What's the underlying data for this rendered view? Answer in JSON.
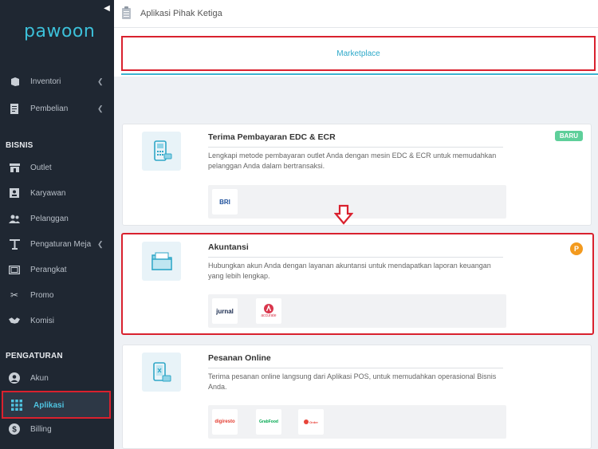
{
  "brand": {
    "logo_text": "pawoon",
    "accent": "#3cc0d9",
    "highlight_color": "#d9212e"
  },
  "sidebar": {
    "top_items": [
      {
        "label": "Inventori",
        "icon": "box-icon",
        "has_submenu": true
      },
      {
        "label": "Pembelian",
        "icon": "receipt-icon",
        "has_submenu": true
      }
    ],
    "section_bisnis": "BISNIS",
    "bisnis_items": [
      {
        "label": "Outlet",
        "icon": "store-icon"
      },
      {
        "label": "Karyawan",
        "icon": "id-card-icon"
      },
      {
        "label": "Pelanggan",
        "icon": "users-icon"
      },
      {
        "label": "Pengaturan Meja",
        "icon": "table-icon",
        "has_submenu": true
      },
      {
        "label": "Perangkat",
        "icon": "tablet-icon"
      },
      {
        "label": "Promo",
        "icon": "scissors-icon"
      },
      {
        "label": "Komisi",
        "icon": "handshake-icon"
      }
    ],
    "section_pengaturan": "PENGATURAN",
    "pengaturan_items": [
      {
        "label": "Akun",
        "icon": "user-circle-icon"
      },
      {
        "label": "Aplikasi",
        "icon": "grid-icon",
        "active": true
      },
      {
        "label": "Billing",
        "icon": "dollar-icon"
      }
    ]
  },
  "header": {
    "title": "Aplikasi Pihak Ketiga"
  },
  "tabs": {
    "active": "Marketplace"
  },
  "cards": [
    {
      "title": "Terima Pembayaran EDC & ECR",
      "description": "Lengkapi metode pembayaran outlet Anda dengan mesin EDC & ECR untuk memudahkan pelanggan Anda dalam bertransaksi.",
      "badge": "BARU",
      "partners": [
        "BRI"
      ]
    },
    {
      "title": "Akuntansi",
      "description": "Hubungkan akun Anda dengan layanan akuntansi untuk mendapatkan laporan keuangan yang lebih lengkap.",
      "badge_icon": "P",
      "partners": [
        "jurnal",
        "accurate"
      ]
    },
    {
      "title": "Pesanan Online",
      "description": "Terima pesanan online langsung dari Aplikasi POS, untuk memudahkan operasional Bisnis Anda.",
      "partners": [
        "digiresto",
        "GrabFood",
        "Order"
      ]
    }
  ]
}
